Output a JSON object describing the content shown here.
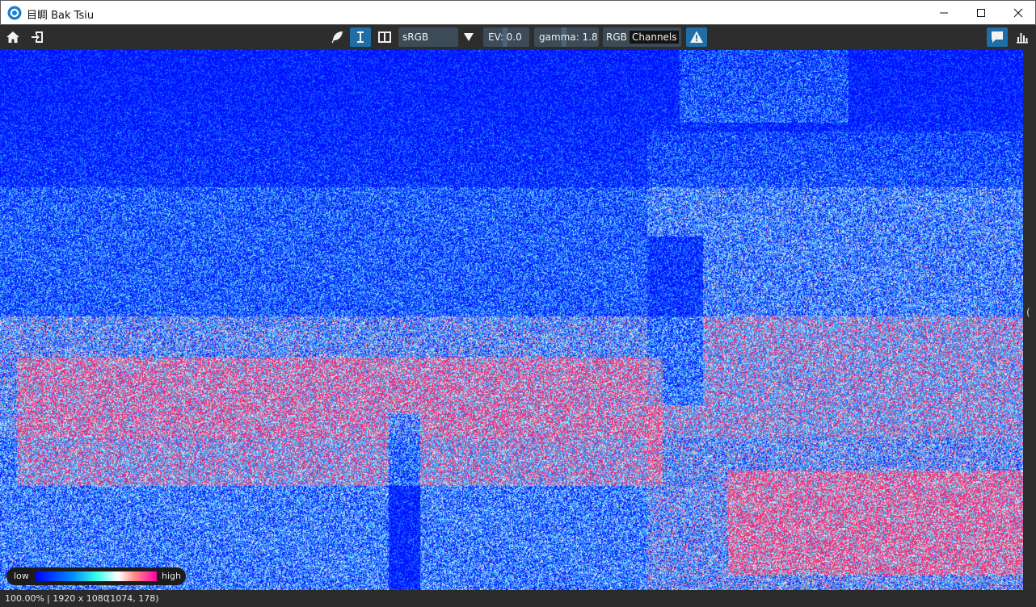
{
  "window": {
    "title": "目睭 Bak Tsiu",
    "controls": {
      "minimize": "—",
      "maximize": "☐",
      "close": "✕"
    }
  },
  "toolbar": {
    "left_icons": [
      "home-icon",
      "open-file-icon"
    ],
    "tool_icons": [
      "feather-icon",
      "text-cursor-icon",
      "split-view-icon"
    ],
    "active_tool": "text-cursor-icon",
    "colorspace": "sRGB",
    "exposure": "EV: 0.0",
    "gamma": "gamma: 1.8",
    "channel_prefix": "RGB",
    "channel_value": "Channels",
    "warning_icon": "warning-icon",
    "right_icons": [
      "comment-icon",
      "histogram-icon"
    ],
    "accent": "#1f6ea8"
  },
  "viewer": {
    "visualization": "heatmap",
    "legend": {
      "low": "low",
      "high": "high"
    }
  },
  "side_panel": {
    "handle": "("
  },
  "status": {
    "zoom": "100.00%",
    "resolution": "| 1920 x 1080",
    "cursor": "(1074, 178)"
  }
}
